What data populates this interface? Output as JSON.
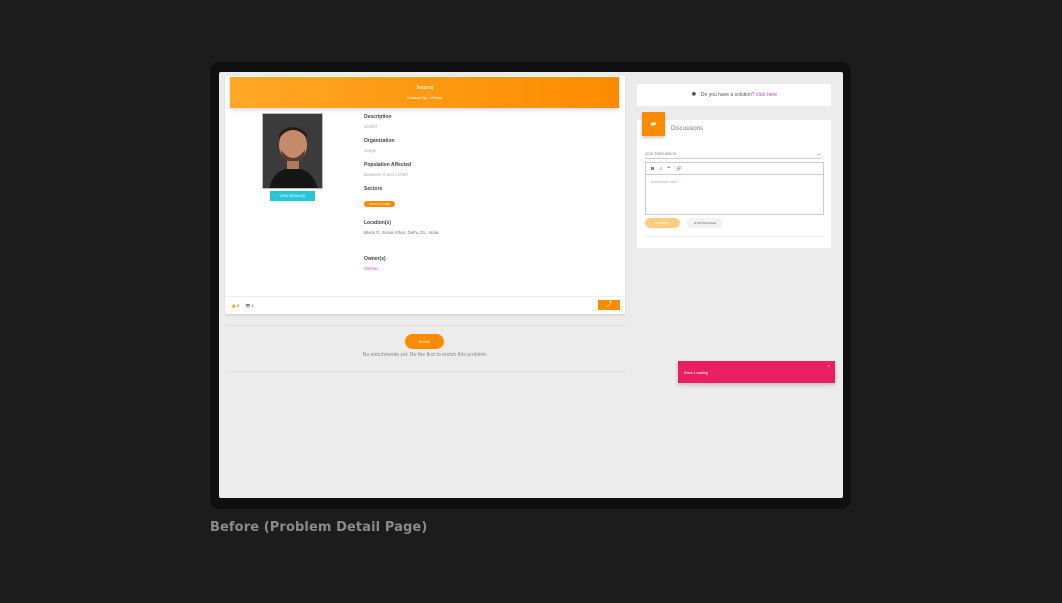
{
  "caption": "Before (Problem Detail Page)",
  "problem": {
    "title": "Testproj",
    "created_by": "Created By : Vishnu",
    "view_media_label": "VIEW MEDIA (2)",
    "fields": {
      "description_label": "Description",
      "description_value": "sfsdfsf",
      "organization_label": "Organization",
      "organization_value": "Jeege",
      "population_label": "Population Affected",
      "population_value": "Between 0 and 10000",
      "sectors_label": "Sectors",
      "sector_chip": "AGRICULTURE",
      "location_label": "Location(s)",
      "location_value": "Block D, Sonia Vihar, Delhi, DL, India",
      "owner_label": "Owner(s)",
      "owner_value": "Vishnu"
    },
    "likes": "0",
    "views": "1"
  },
  "enrich": {
    "button_label": "Enrich",
    "empty_text": "No enrichments yet. Be the first to enrich this problem."
  },
  "solution": {
    "prompt": "Do you have a solution?",
    "link": "click here"
  },
  "discussions": {
    "title": "Discussions",
    "join_label": "Join Discussion",
    "toolbar": {
      "bold": "B",
      "italic": "I",
      "quote": "❞",
      "link": "🔗"
    },
    "placeholder": "Insert text here ...",
    "post_label": "COMMENT",
    "attach_label": "ATTACH FILE"
  },
  "toast": {
    "message": "Error Loading",
    "close": "×"
  },
  "colors": {
    "accent": "#fb8c00",
    "toast": "#e91e63",
    "link": "#ab47bc",
    "media": "#26c6da"
  }
}
